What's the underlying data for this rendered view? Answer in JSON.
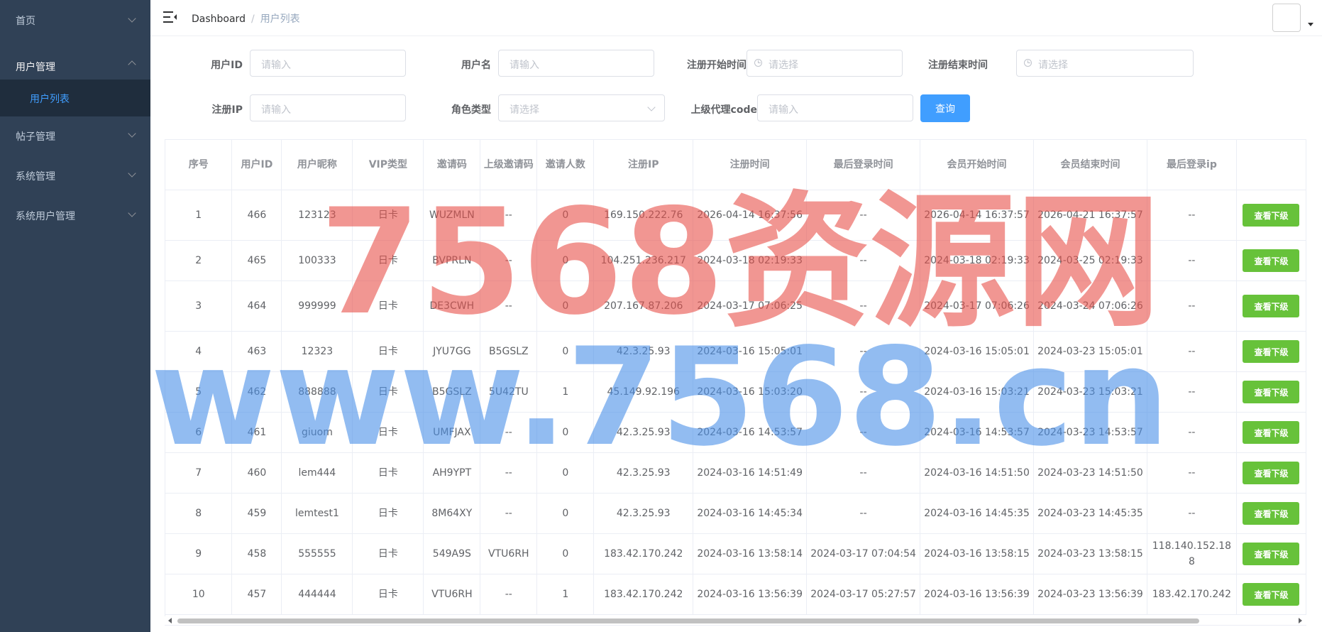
{
  "sidebar": {
    "menu": [
      {
        "label": "首页",
        "expanded": false
      },
      {
        "label": "用户管理",
        "expanded": true,
        "children": [
          {
            "label": "用户列表",
            "active": true
          }
        ]
      },
      {
        "label": "帖子管理",
        "expanded": false
      },
      {
        "label": "系统管理",
        "expanded": false
      },
      {
        "label": "系统用户管理",
        "expanded": false
      }
    ]
  },
  "navbar": {
    "breadcrumb": [
      "Dashboard",
      "用户列表"
    ],
    "avatar_icon": "avatar-image",
    "menu_toggle_icon": "hamburger-icon"
  },
  "filters": {
    "user_id": {
      "label": "用户ID",
      "placeholder": "请输入"
    },
    "username": {
      "label": "用户名",
      "placeholder": "请输入"
    },
    "reg_start": {
      "label": "注册开始时间",
      "placeholder": "请选择"
    },
    "reg_end": {
      "label": "注册结束时间",
      "placeholder": "请选择"
    },
    "reg_ip": {
      "label": "注册IP",
      "placeholder": "请输入"
    },
    "role_type": {
      "label": "角色类型",
      "placeholder": "请选择"
    },
    "parent_code": {
      "label": "上级代理code",
      "placeholder": "请输入"
    },
    "query_button": "查询"
  },
  "table": {
    "columns": [
      "序号",
      "用户ID",
      "用户昵称",
      "VIP类型",
      "邀请码",
      "上级邀请码",
      "邀请人数",
      "注册IP",
      "注册时间",
      "最后登录时间",
      "会员开始时间",
      "会员结束时间",
      "最后登录ip",
      ""
    ],
    "action_label": "查看下级",
    "rows": [
      [
        "1",
        "466",
        "123123",
        "日卡",
        "WUZMLN",
        "--",
        "0",
        "169.150.222.76",
        "2026-04-14 16:37:56",
        "--",
        "2026-04-14 16:37:57",
        "2026-04-21 16:37:57",
        "--"
      ],
      [
        "2",
        "465",
        "100333",
        "日卡",
        "BVPRLN",
        "--",
        "0",
        "104.251.236.217",
        "2024-03-18 02:19:33",
        "--",
        "2024-03-18 02:19:33",
        "2024-03-25 02:19:33",
        "--"
      ],
      [
        "3",
        "464",
        "999999",
        "日卡",
        "DE3CWH",
        "--",
        "0",
        "207.167.87.206",
        "2024-03-17 07:06:25",
        "--",
        "2024-03-17 07:06:26",
        "2024-03-24 07:06:26",
        "--"
      ],
      [
        "4",
        "463",
        "12323",
        "日卡",
        "JYU7GG",
        "B5GSLZ",
        "0",
        "42.3.25.93",
        "2024-03-16 15:05:01",
        "--",
        "2024-03-16 15:05:01",
        "2024-03-23 15:05:01",
        "--"
      ],
      [
        "5",
        "462",
        "888888",
        "日卡",
        "B5GSLZ",
        "5U42TU",
        "1",
        "45.149.92.196",
        "2024-03-16 15:03:20",
        "--",
        "2024-03-16 15:03:21",
        "2024-03-23 15:03:21",
        "--"
      ],
      [
        "6",
        "461",
        "giuom",
        "日卡",
        "UMFJAX",
        "--",
        "0",
        "42.3.25.93",
        "2024-03-16 14:53:57",
        "--",
        "2024-03-16 14:53:57",
        "2024-03-23 14:53:57",
        "--"
      ],
      [
        "7",
        "460",
        "lem444",
        "日卡",
        "AH9YPT",
        "--",
        "0",
        "42.3.25.93",
        "2024-03-16 14:51:49",
        "--",
        "2024-03-16 14:51:50",
        "2024-03-23 14:51:50",
        "--"
      ],
      [
        "8",
        "459",
        "lemtest1",
        "日卡",
        "8M64XY",
        "--",
        "0",
        "42.3.25.93",
        "2024-03-16 14:45:34",
        "--",
        "2024-03-16 14:45:35",
        "2024-03-23 14:45:35",
        "--"
      ],
      [
        "9",
        "458",
        "555555",
        "日卡",
        "549A9S",
        "VTU6RH",
        "0",
        "183.42.170.242",
        "2024-03-16 13:58:14",
        "2024-03-17 07:04:54",
        "2024-03-16 13:58:15",
        "2024-03-23 13:58:15",
        "118.140.152.188"
      ],
      [
        "10",
        "457",
        "444444",
        "日卡",
        "VTU6RH",
        "--",
        "1",
        "183.42.170.242",
        "2024-03-16 13:56:39",
        "2024-03-17 05:27:57",
        "2024-03-16 13:56:39",
        "2024-03-23 13:56:39",
        "183.42.170.242"
      ]
    ]
  },
  "watermark": {
    "line1": "7568资源网",
    "line2": "www.7568.cn",
    "color1": "#e8504a",
    "color2": "#4a90e8"
  },
  "colors": {
    "sidebar_bg": "#304156",
    "active": "#409eff",
    "success": "#67c23a"
  }
}
